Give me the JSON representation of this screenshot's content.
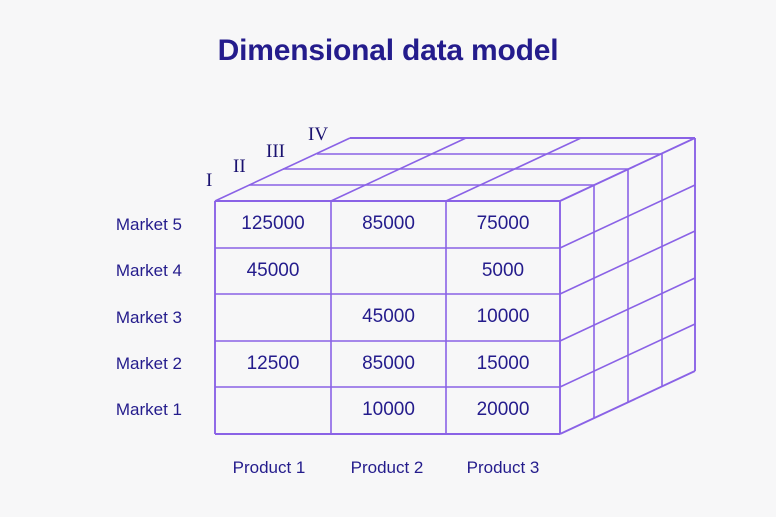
{
  "title": "Dimensional data model",
  "colors": {
    "background": "#f7f7f8",
    "text": "#241c8c",
    "grid_line": "#8a62e6"
  },
  "chart_data": {
    "type": "table",
    "title": "Dimensional data model",
    "xlabel": "",
    "ylabel": "",
    "categories": [
      "Product 1",
      "Product 2",
      "Product 3"
    ],
    "rows": [
      "Market 5",
      "Market 4",
      "Market 3",
      "Market 2",
      "Market 1"
    ],
    "depth_labels": [
      "I",
      "II",
      "III",
      "IV"
    ],
    "values": [
      [
        "125000",
        "85000",
        "75000"
      ],
      [
        "45000",
        "",
        "5000"
      ],
      [
        "",
        "45000",
        "10000"
      ],
      [
        "12500",
        "85000",
        "15000"
      ],
      [
        "",
        "10000",
        "20000"
      ]
    ],
    "series": [
      {
        "name": "Market 5",
        "values": [
          125000,
          85000,
          75000
        ]
      },
      {
        "name": "Market 4",
        "values": [
          45000,
          null,
          5000
        ]
      },
      {
        "name": "Market 3",
        "values": [
          null,
          45000,
          10000
        ]
      },
      {
        "name": "Market 2",
        "values": [
          12500,
          85000,
          15000
        ]
      },
      {
        "name": "Market 1",
        "values": [
          null,
          10000,
          20000
        ]
      }
    ],
    "grid": true,
    "legend": "none",
    "depth_slices": 4
  },
  "cells": {
    "r0c0": "125000",
    "r0c1": "85000",
    "r0c2": "75000",
    "r1c0": "45000",
    "r1c1": "",
    "r1c2": "5000",
    "r2c0": "",
    "r2c1": "45000",
    "r2c2": "10000",
    "r3c0": "12500",
    "r3c1": "85000",
    "r3c2": "15000",
    "r4c0": "",
    "r4c1": "10000",
    "r4c2": "20000"
  },
  "row_labels": {
    "r0": "Market 5",
    "r1": "Market 4",
    "r2": "Market 3",
    "r3": "Market 2",
    "r4": "Market 1"
  },
  "col_labels": {
    "c0": "Product 1",
    "c1": "Product 2",
    "c2": "Product 3"
  },
  "depth": {
    "d0": "I",
    "d1": "II",
    "d2": "III",
    "d3": "IV"
  }
}
